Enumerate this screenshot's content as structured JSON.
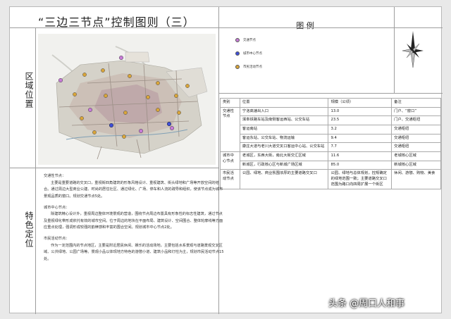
{
  "title": "“三边三节点”控制图则（三）",
  "legend_header": "图 例",
  "sections": {
    "region": "区域位置",
    "features": "特色定位"
  },
  "legend_items": [
    {
      "label": "交通节点",
      "color": "#c77bd6"
    },
    {
      "label": "城市中心节点",
      "color": "#3f4fd8"
    },
    {
      "label": "市民活动节点",
      "color": "#d9a53a"
    }
  ],
  "table": {
    "headers": [
      "类别",
      "位置",
      "规模（公顷）",
      "备注"
    ],
    "rows": [
      {
        "category": "交通性节点",
        "location": "宁洛高速出入口",
        "scale": "13.0",
        "note": "门户、“窗口”"
      },
      {
        "category": "",
        "location": "漯阜铁路车站及南侧客运西站、公交车站",
        "scale": "23.5",
        "note": "门户、交通枢纽"
      },
      {
        "category": "",
        "location": "客运南站",
        "scale": "3.2",
        "note": "交通枢纽"
      },
      {
        "category": "",
        "location": "客运东站、公交车站、物流运输",
        "scale": "9.4",
        "note": "交通枢纽"
      },
      {
        "category": "",
        "location": "康庄大道与老川大道交叉口客运中心站、公交车站",
        "scale": "7.7",
        "note": "交通枢纽"
      },
      {
        "category": "城市中心节点",
        "location": "老城区，东西大街，南北大街交汇区域",
        "scale": "11.6",
        "note": "老城核心区域"
      },
      {
        "category": "",
        "location": "新城区，行政核心区与新城广场区域",
        "scale": "85.0",
        "note": "新城核心区域"
      },
      {
        "category": "市民活动节点",
        "location": "公园、绿地、商业氛围浓厚的主要道路交叉口",
        "scale": "公园、绿地与总体规划，控规确定的绿地范围一致；主要道路交叉口范围为路口向四周扩展一个街区",
        "note": "休闲、游憩、购物、美食"
      }
    ]
  },
  "description": {
    "traffic_title": "交通性节点：",
    "traffic_body": "主要是重要道路的交叉口，重视街四角建筑的形象风格设计、重视建筑、街头绿地和广场等开放空间的结合。通过周边大型商业公建、时尚的居住社区、通过绿化、广场、停车和人流的疏导和组织，使该节点成为城市景观品质的窗口。规划交通节点5处。",
    "center_title": "城市中心节点：",
    "center_body": "除建筑精心设计外，重视周边整体环境景观的营造，围绕节点周边布置具有形象性的标志性建筑，通过节点及重视绿化带形成依托有效的城市空间。位于周边的地块在平面布局、建筑设计、空间围合、整体轮廓线等方面应重点处理，强调形成较强的韵律感和丰富的围合空间。规划城市中心节点2处。",
    "civic_title": "市民活动节点：",
    "civic_body": "作为一定范围内的节点地区，主要是附近居民休闲、娱乐的活动场地，主要包括水系景观与道路景观交叉区域、公共绿地、公园广场等。景观小品以体现地方特色的游憩小道、建筑小品和灯柱为主，规划市民活动节点15处。"
  },
  "watermark": "头条 @周口人和事"
}
